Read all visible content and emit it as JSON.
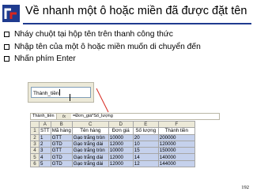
{
  "title": "Về nhanh một ô hoặc miền đã được đặt tên",
  "bullets": [
    "Nháy chuột tại hộp tên trên thanh công thức",
    "Nhập tên của một ô hoặc miền muốn di chuyển đến",
    "Nhấn phím Enter"
  ],
  "name_box_value": "Thành_tiền",
  "formula_bar": {
    "name": "Thành_tiền",
    "fx": "fx",
    "formula": "=Đơn_giá*Số_lượng"
  },
  "sheet": {
    "column_letters": [
      "A",
      "B",
      "C",
      "D",
      "E",
      "F"
    ],
    "headers": [
      "STT",
      "Mã hàng",
      "Tên hàng",
      "Đơn giá",
      "Số lượng",
      "Thành tiền"
    ],
    "rows": [
      {
        "row": "2",
        "cells": [
          "1",
          "GTT",
          "Gạo trắng tròn",
          "10000",
          "20",
          "200000"
        ]
      },
      {
        "row": "3",
        "cells": [
          "2",
          "GTD",
          "Gạo trắng dài",
          "12000",
          "10",
          "120000"
        ]
      },
      {
        "row": "4",
        "cells": [
          "3",
          "GTT",
          "Gạo trắng tròn",
          "10000",
          "15",
          "150000"
        ]
      },
      {
        "row": "5",
        "cells": [
          "4",
          "GTD",
          "Gạo trắng dài",
          "12000",
          "14",
          "140000"
        ]
      },
      {
        "row": "6",
        "cells": [
          "5",
          "GTD",
          "Gạo trắng dài",
          "12000",
          "12",
          "144000"
        ]
      }
    ],
    "header_row_number": "1"
  },
  "page_number": "192",
  "colors": {
    "title_rule": "#1f3b8f",
    "logo_blue": "#1f3b8f",
    "logo_red": "#d7261e",
    "selection": "#c5d1ec"
  }
}
